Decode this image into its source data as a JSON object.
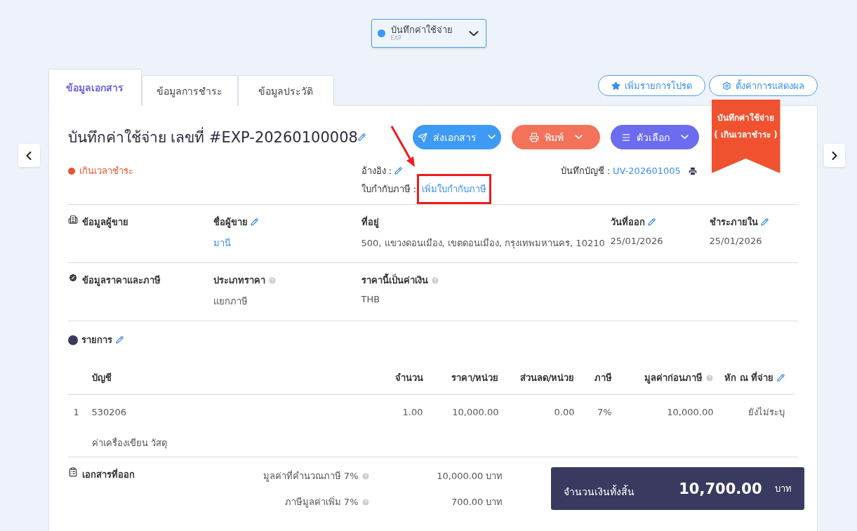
{
  "doc_type_select": {
    "label": "บันทึกค่าใช้จ่าย",
    "sub": "EXP",
    "color": "#3b97f7"
  },
  "tabs": [
    {
      "label": "ข้อมูลเอกสาร",
      "selected": true
    },
    {
      "label": "ข้อมูลการชำระ",
      "selected": false
    },
    {
      "label": "ข้อมูลประวัติ",
      "selected": false
    }
  ],
  "actions": [
    {
      "label": "เพิ่มรายการโปรด",
      "kind": "star"
    },
    {
      "label": "ตั้งค่าการแสดงผล",
      "kind": "gear"
    }
  ],
  "ribbon": {
    "lines": [
      "บันทึกค่าใช้จ่าย",
      "( เกินเวลาชำระ )"
    ]
  },
  "title": "บันทึกค่าใช้จ่าย เลขที่ #EXP-20260100008",
  "buttons": [
    {
      "label": "ส่งเอกสาร",
      "kind": "send",
      "color": "#3d9af5"
    },
    {
      "label": "พิมพ์",
      "kind": "print",
      "color": "#f2735a"
    },
    {
      "label": "ตัวเลือก",
      "kind": "menu",
      "color": "#6c6cf0"
    }
  ],
  "status": {
    "label": "เกินเวลาชำระ",
    "color": "#f0522f"
  },
  "reference": {
    "label": "อ้างอิง :"
  },
  "tax_invoice": {
    "label": "ใบกำกับภาษี :",
    "link": "เพิ่มใบกำกับภาษี"
  },
  "journal": {
    "label": "บันทึกบัญชี :",
    "link": "UV-202601005"
  },
  "sections": [
    {
      "title": "ข้อมูลผู้ขาย",
      "kind": "vendor",
      "fields": [
        {
          "label": "ชื่อผู้ขาย",
          "kind": "edit",
          "value": "มานี",
          "link": true
        },
        {
          "label": "ที่อยู่",
          "kind": "plain",
          "value": "500, แขวงดอนเมือง, เขตดอนเมือง, กรุงเทพมหานคร, 10210",
          "link": false
        },
        {
          "label": "วันที่ออก",
          "kind": "edit",
          "value": "25/01/2026",
          "link": false
        },
        {
          "label": "ชำระภายใน",
          "kind": "edit",
          "value": "25/01/2026",
          "link": false
        }
      ]
    },
    {
      "title": "ข้อมูลราคาและภาษี",
      "kind": "price",
      "fields": [
        {
          "label": "ประเภทราคา",
          "kind": "help",
          "value": "แยกภาษี",
          "link": false
        },
        {
          "label": "ราคานี้เป็นค่าเงิน",
          "kind": "help",
          "value": "THB",
          "link": false
        }
      ]
    }
  ],
  "items": {
    "title": "รายการ",
    "columns": [
      {
        "label": "บัญชี",
        "kind": "plain"
      },
      {
        "label": "จำนวน",
        "kind": "plain"
      },
      {
        "label": "ราคา/หน่วย",
        "kind": "plain"
      },
      {
        "label": "ส่วนลด/หน่วย",
        "kind": "plain"
      },
      {
        "label": "ภาษี",
        "kind": "plain"
      },
      {
        "label": "มูลค่าก่อนภาษี",
        "kind": "help"
      },
      {
        "label": "หัก ณ ที่จ่าย",
        "kind": "edit"
      }
    ],
    "rows": [
      {
        "no": "1",
        "cells": [
          "530206",
          "1.00",
          "10,000.00",
          "0.00",
          "7%",
          "10,000.00",
          "ยังไม่ระบุ"
        ],
        "description": "ค่าเครื่องเขียน วัสดุ"
      }
    ]
  },
  "summary": {
    "title": "เอกสารที่ออก",
    "lines": [
      {
        "label": "มูลค่าที่คำนวณภาษี 7%",
        "value": "10,000.00 บาท"
      },
      {
        "label": "ภาษีมูลค่าเพิ่ม 7%",
        "value": "700.00 บาท"
      }
    ],
    "total": {
      "label": "จำนวนเงินทั้งสิ้น",
      "value": "10,700.00",
      "unit": "บาท"
    }
  }
}
